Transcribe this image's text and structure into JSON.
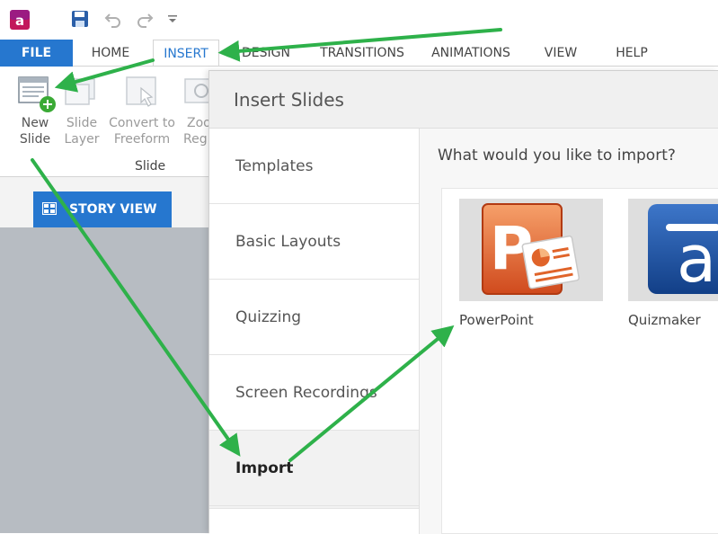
{
  "qat": {
    "app_icon": "articulate-storyline-icon",
    "save_icon": "save-icon",
    "undo_icon": "undo-icon",
    "redo_icon": "redo-icon",
    "more_icon": "dropdown-arrow-icon"
  },
  "tabs": {
    "file": "FILE",
    "home": "HOME",
    "insert": "INSERT",
    "design": "DESIGN",
    "transitions": "TRANSITIONS",
    "animations": "ANIMATIONS",
    "view": "VIEW",
    "help": "HELP"
  },
  "ribbon": {
    "new_slide": {
      "line1": "New",
      "line2": "Slide"
    },
    "slide_layer": {
      "line1": "Slide",
      "line2": "Layer"
    },
    "convert": {
      "line1": "Convert to",
      "line2": "Freeform"
    },
    "zoom": {
      "line1": "Zoo",
      "line2": "Reg"
    },
    "group_label": "Slide"
  },
  "story_view": {
    "label": "STORY VIEW"
  },
  "dialog": {
    "title": "Insert Slides",
    "categories": [
      "Templates",
      "Basic Layouts",
      "Quizzing",
      "Screen Recordings",
      "Import"
    ],
    "selected": "Import",
    "question": "What would you like to import?",
    "options": [
      {
        "label": "PowerPoint",
        "icon": "powerpoint-icon"
      },
      {
        "label": "Quizmaker",
        "icon": "quizmaker-icon"
      }
    ]
  },
  "colors": {
    "accent": "#2677cf",
    "arrow": "#2eb14a",
    "powerpoint": "#d04a1d"
  }
}
